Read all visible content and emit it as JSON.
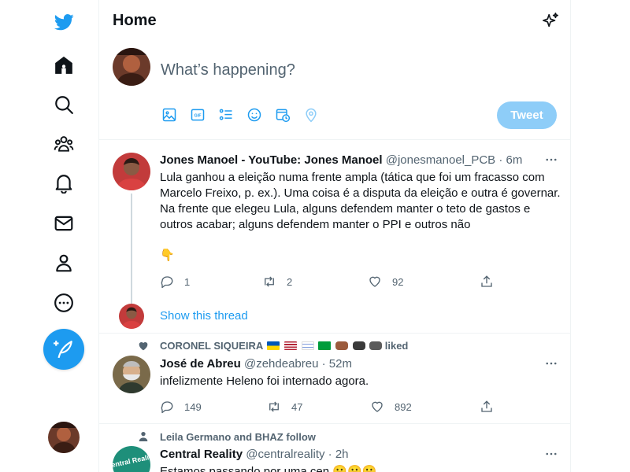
{
  "header": {
    "title": "Home"
  },
  "composer": {
    "placeholder": "What’s happening?",
    "tweet_label": "Tweet"
  },
  "tweets": [
    {
      "name": "Jones Manoel - YouTube: Jones Manoel",
      "handle": "@jonesmanoel_PCB",
      "time": "· 6m",
      "text": "Lula ganhou a eleição numa frente ampla (tática que foi um fracasso com Marcelo Freixo, p. ex.). Uma coisa é a disputa da eleição e outra é governar. Na frente que elegeu Lula, alguns defendem manter o teto de gastos e outros acabar; alguns defendem manter o PPI e outros não",
      "emoji": "👇",
      "replies": "1",
      "retweets": "2",
      "likes": "92",
      "show_thread": "Show this thread"
    },
    {
      "context": "CORONEL SIQUEIRA",
      "context_suffix": "liked",
      "name": "José de Abreu",
      "handle": "@zehdeabreu",
      "time": "· 52m",
      "text": "infelizmente Heleno foi internado agora.",
      "replies": "149",
      "retweets": "47",
      "likes": "892"
    },
    {
      "context": "Leila Germano and BHAZ follow",
      "name": "Central Reality",
      "handle": "@centralreality",
      "time": "· 2h",
      "text": "Estamos passando por uma cen",
      "emoji": "😬😬😬",
      "avatar_text": "Central Reality"
    }
  ],
  "colors": {
    "accent": "#1d9bf0",
    "tweet_button_disabled": "#8ecdf8",
    "text_secondary": "#536471"
  },
  "icons": [
    "twitter-logo-icon",
    "home-icon",
    "explore-icon",
    "communities-icon",
    "notifications-icon",
    "messages-icon",
    "profile-icon",
    "more-icon",
    "compose-icon",
    "sparkle-icon",
    "image-icon",
    "gif-icon",
    "poll-icon",
    "emoji-icon",
    "schedule-icon",
    "location-icon",
    "reply-icon",
    "retweet-icon",
    "like-icon",
    "share-icon",
    "more-dots-icon",
    "heart-icon",
    "person-icon"
  ]
}
